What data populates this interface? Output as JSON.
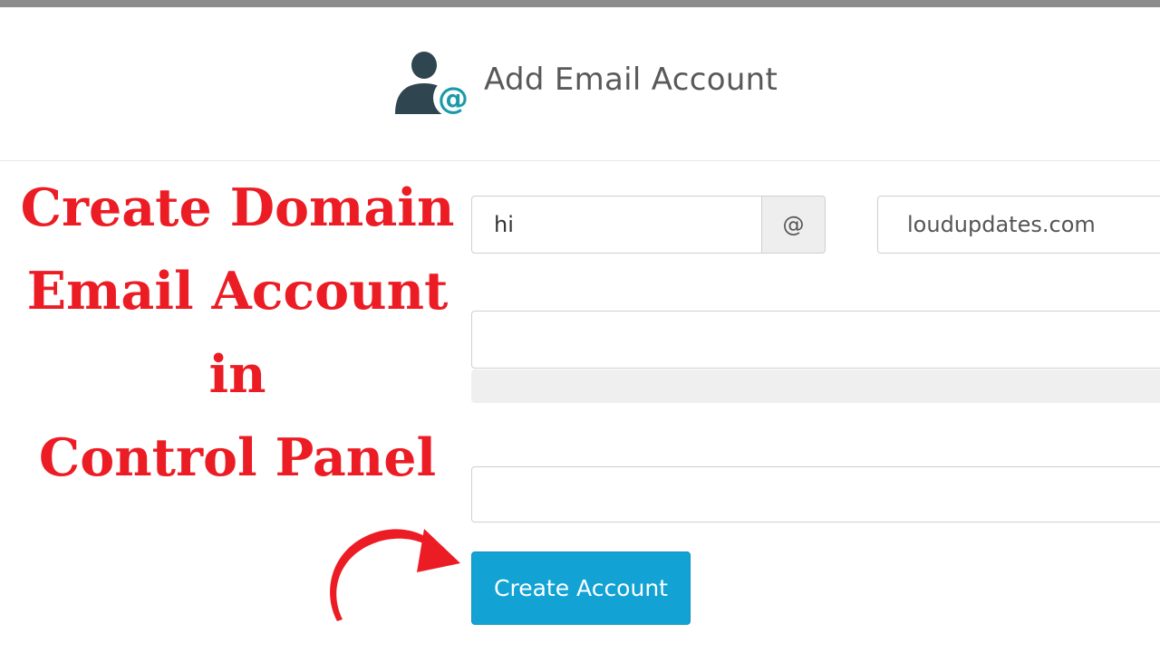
{
  "header": {
    "title": "Add Email Account",
    "icon": "user-at-icon",
    "icon_colors": {
      "user": "#2f4550",
      "at": "#1a9aa8"
    }
  },
  "overlay": {
    "lines": [
      "Create Domain",
      "Email Account",
      "in",
      "Control Panel"
    ],
    "color": "#ec1c24",
    "arrow_icon": "curved-arrow-icon"
  },
  "form": {
    "username": {
      "value": "hi"
    },
    "at_symbol": "@",
    "domain": {
      "value": "loudupdates.com"
    },
    "password": {
      "value": ""
    },
    "password_strength": {
      "fraction": 0
    },
    "confirm_password": {
      "value": ""
    },
    "submit_label": "Create Account",
    "accent_color": "#12a3d4"
  }
}
